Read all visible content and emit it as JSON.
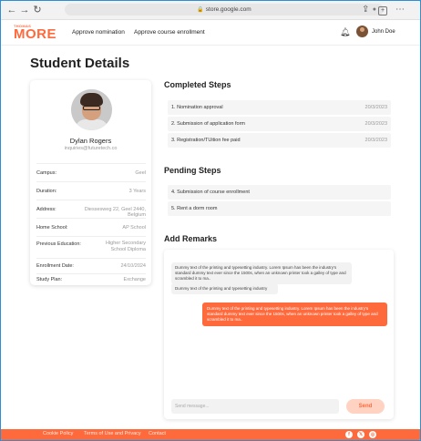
{
  "browser": {
    "url": "store.google.com",
    "back_icon": "arrow-left-icon",
    "forward_icon": "arrow-right-icon",
    "reload_icon": "reload-icon"
  },
  "header": {
    "logo_small": "THOMAS",
    "logo_big": "MORE",
    "nav": [
      "Approve nomination",
      "Approve course enrollment"
    ],
    "user_name": "John Doe"
  },
  "page": {
    "title": "Student Details"
  },
  "profile": {
    "name": "Dylan Rogers",
    "email": "inquiries@futuretech.co",
    "fields": [
      {
        "label": "Campus:",
        "value": "Geel"
      },
      {
        "label": "Duration:",
        "value": "3 Years"
      },
      {
        "label": "Address:",
        "value": "Diessesweg 22, Geel 2440, Belgium"
      },
      {
        "label": "Home School:",
        "value": "AP School"
      },
      {
        "label": "Previous Education:",
        "value": "Higher Secondary School Diploma"
      },
      {
        "label": "Enrollment Date:",
        "value": "24/10/2024"
      },
      {
        "label": "Study Plan:",
        "value": "Exchange"
      }
    ]
  },
  "completed": {
    "title": "Completed Steps",
    "steps": [
      {
        "label": "1. Nomination approval",
        "date": "20/3/2023"
      },
      {
        "label": "2. Submission of  application form",
        "date": "20/3/2023"
      },
      {
        "label": "3. Registration/TUition fee paid",
        "date": "20/3/2023"
      }
    ]
  },
  "pending": {
    "title": "Pending Steps",
    "steps": [
      {
        "label": "4. Submission of  course enrollment"
      },
      {
        "label": "5. Rent a dorm room"
      }
    ]
  },
  "remarks": {
    "title": "Add Remarks",
    "messages": [
      {
        "text": "Dummy text of the printing and typesetting industry. Lorem Ipsum has been the industry's standard dummy text ever since the 1500s, when an unknown printer took a galley of type and scrambled it to ma..",
        "direction": "in"
      },
      {
        "text": "Dummy text of the printing and typesetting industry",
        "direction": "in"
      },
      {
        "text": "Dummy text of the printing and typesetting industry. Lorem Ipsum has been the industry's standard dummy text ever since the 1500s, when an unknown printer took a galley of type and scrambled it to ma..",
        "direction": "out"
      }
    ],
    "input_placeholder": "Send message...",
    "send_label": "Send"
  },
  "footer": {
    "links": [
      "Cookie Policy",
      "Terms of Use and Privacy",
      "Contact"
    ],
    "social_icons": [
      "facebook-icon",
      "twitter-icon",
      "instagram-icon"
    ]
  },
  "colors": {
    "accent": "#ff6a3d",
    "frame": "#2f8fd6"
  }
}
